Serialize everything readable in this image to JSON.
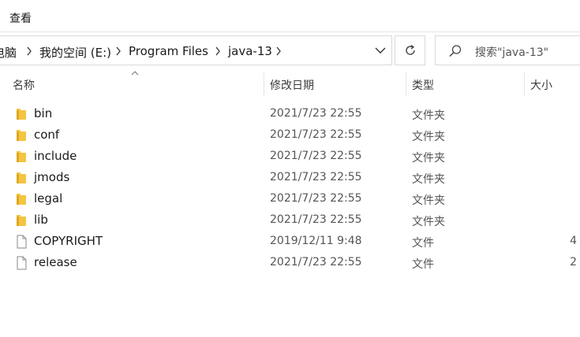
{
  "menu": {
    "view_label": "查看"
  },
  "address": {
    "crumbs": [
      "电脑",
      "我的空间 (E:)",
      "Program Files",
      "java-13"
    ]
  },
  "search": {
    "placeholder": "搜索\"java-13\""
  },
  "columns": {
    "name": "名称",
    "modified": "修改日期",
    "type": "类型",
    "size": "大小"
  },
  "files": [
    {
      "name": "bin",
      "modified": "2021/7/23 22:55",
      "type": "文件夹",
      "size": "",
      "kind": "folder"
    },
    {
      "name": "conf",
      "modified": "2021/7/23 22:55",
      "type": "文件夹",
      "size": "",
      "kind": "folder"
    },
    {
      "name": "include",
      "modified": "2021/7/23 22:55",
      "type": "文件夹",
      "size": "",
      "kind": "folder"
    },
    {
      "name": "jmods",
      "modified": "2021/7/23 22:55",
      "type": "文件夹",
      "size": "",
      "kind": "folder"
    },
    {
      "name": "legal",
      "modified": "2021/7/23 22:55",
      "type": "文件夹",
      "size": "",
      "kind": "folder"
    },
    {
      "name": "lib",
      "modified": "2021/7/23 22:55",
      "type": "文件夹",
      "size": "",
      "kind": "folder"
    },
    {
      "name": "COPYRIGHT",
      "modified": "2019/12/11 9:48",
      "type": "文件",
      "size": "4",
      "kind": "file"
    },
    {
      "name": "release",
      "modified": "2021/7/23 22:55",
      "type": "文件",
      "size": "2",
      "kind": "file"
    }
  ],
  "colors": {
    "folder": "#f4c542",
    "folder_dark": "#e0a820",
    "border": "#d9d9d9"
  }
}
